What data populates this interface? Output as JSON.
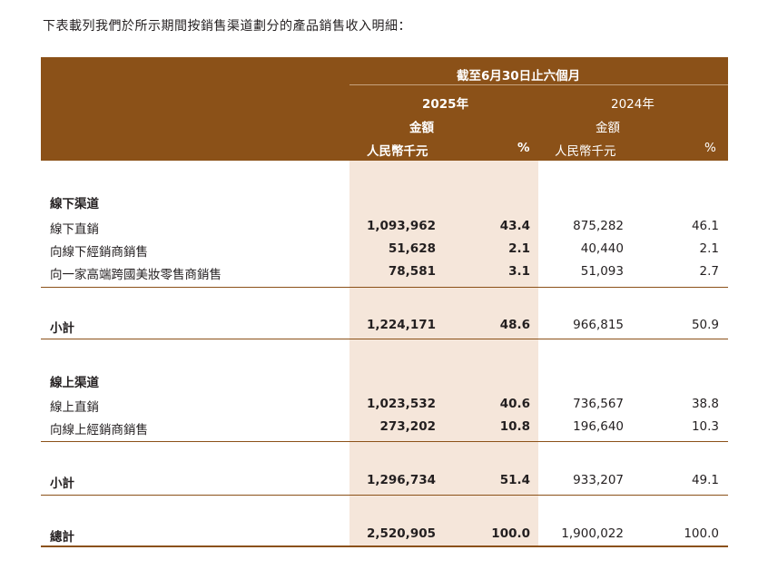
{
  "intro": "下表載列我們於所示期間按銷售渠道劃分的產品銷售收入明細：",
  "header": {
    "period": "截至6月30日止六個月",
    "y2025": "2025年",
    "y2024": "2024年",
    "amount_2025": "金額",
    "amount_2024": "金額",
    "unit_2025": "人民幣千元",
    "pct_2025": "%",
    "unit_2024": "人民幣千元",
    "pct_2024": "%"
  },
  "rows": [
    {
      "label": "線下渠道"
    },
    {
      "label": "線下直銷",
      "a25": "1,093,962",
      "p25": "43.4",
      "a24": "875,282",
      "p24": "46.1"
    },
    {
      "label": "向線下經銷商銷售",
      "a25": "51,628",
      "p25": "2.1",
      "a24": "40,440",
      "p24": "2.1"
    },
    {
      "label": "向一家高端跨國美妝零售商銷售",
      "a25": "78,581",
      "p25": "3.1",
      "a24": "51,093",
      "p24": "2.7"
    },
    {
      "label": "小計",
      "a25": "1,224,171",
      "p25": "48.6",
      "a24": "966,815",
      "p24": "50.9"
    },
    {
      "label": "線上渠道"
    },
    {
      "label": "線上直銷",
      "a25": "1,023,532",
      "p25": "40.6",
      "a24": "736,567",
      "p24": "38.8"
    },
    {
      "label": "向線上經銷商銷售",
      "a25": "273,202",
      "p25": "10.8",
      "a24": "196,640",
      "p24": "10.3"
    },
    {
      "label": "小計",
      "a25": "1,296,734",
      "p25": "51.4",
      "a24": "933,207",
      "p24": "49.1"
    },
    {
      "label": "總計",
      "a25": "2,520,905",
      "p25": "100.0",
      "a24": "1,900,022",
      "p24": "100.0"
    }
  ]
}
